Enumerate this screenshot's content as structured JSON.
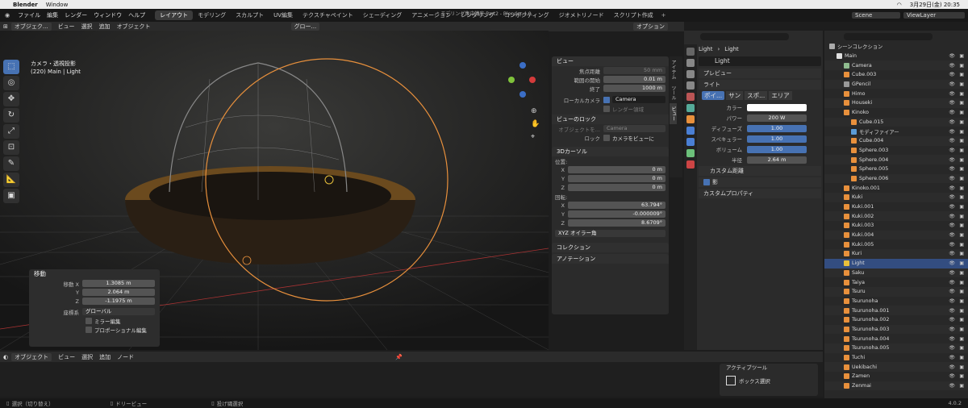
{
  "mac": {
    "app": "Blender",
    "window": "Window",
    "datetime": "3月29日(金) 20:35"
  },
  "title": "* モデリング集中講座 Part2 - Blender 4.0",
  "topmenu": [
    "ファイル",
    "編集",
    "レンダー",
    "ウィンドウ",
    "ヘルプ"
  ],
  "workspaces": [
    "レイアウト",
    "モデリング",
    "スカルプト",
    "UV編集",
    "テクスチャペイント",
    "シェーディング",
    "アニメーション",
    "レンダリング",
    "コンポジティング",
    "ジオメトリノード",
    "スクリプト作成"
  ],
  "scene": "Scene",
  "viewlayer": "ViewLayer",
  "vp_header": {
    "mode": "オブジェク...",
    "menus": [
      "ビュー",
      "選択",
      "追加",
      "オブジェクト"
    ],
    "transform": "グロー...",
    "options": "オプション"
  },
  "vp_overlay": {
    "line1": "カメラ・透視投影",
    "line2": "(220) Main | Light"
  },
  "npanel": {
    "view_title": "ビュー",
    "focal_label": "焦点距離",
    "focal": "50 mm",
    "clip_start_label": "範囲の開始",
    "clip_start": "0.01 m",
    "clip_end_label": "終了",
    "clip_end": "1000 m",
    "local_cam_label": "ローカルカメラ",
    "local_cam": "Camera",
    "render_region": "レンダー領域",
    "lock_title": "ビューのロック",
    "lock_obj_label": "オブジェクトを...",
    "lock_obj": "Camera",
    "lock_label": "ロック",
    "lock_cam": "カメラをビューに",
    "cursor_title": "3Dカーソル",
    "loc_label": "位置:",
    "x": "0 m",
    "y": "0 m",
    "z": "0 m",
    "rot_label": "回転:",
    "rx": "63.794°",
    "ry": "-0.000009°",
    "rz": "8.6709°",
    "rot_mode": "XYZ オイラー角",
    "collection": "コレクション",
    "annotation": "アノテーション"
  },
  "sidetabs": [
    "アイテム",
    "ツール",
    "ビュー"
  ],
  "props": {
    "breadcrumb1": "Light",
    "breadcrumb2": "Light",
    "datablock": "Light",
    "preview": "プレビュー",
    "light": "ライト",
    "types": [
      "ポイ...",
      "サン",
      "スポ...",
      "エリア"
    ],
    "color_label": "カラー",
    "power_label": "パワー",
    "power": "200 W",
    "diffuse_label": "ディフューズ",
    "diffuse": "1.00",
    "specular_label": "スペキュラー",
    "specular": "1.00",
    "volume_label": "ボリューム",
    "volume": "1.00",
    "radius_label": "半径",
    "radius": "2.64 m",
    "custom_dist": "カスタム距離",
    "shadow": "影",
    "custom_props": "カスタムプロパティ"
  },
  "outliner": {
    "root": "シーンコレクション",
    "items": [
      {
        "name": "Main",
        "indent": 1,
        "color": "#e0e0e0"
      },
      {
        "name": "Camera",
        "indent": 2,
        "color": "#8fbc8f"
      },
      {
        "name": "Cube.003",
        "indent": 2,
        "color": "#e8903c"
      },
      {
        "name": "GPencil",
        "indent": 2,
        "color": "#999999"
      },
      {
        "name": "Himo",
        "indent": 2,
        "color": "#e8903c"
      },
      {
        "name": "Houseki",
        "indent": 2,
        "color": "#e8903c"
      },
      {
        "name": "Kinoko",
        "indent": 2,
        "color": "#e8903c"
      },
      {
        "name": "Cube.015",
        "indent": 3,
        "color": "#e8903c"
      },
      {
        "name": "モディファイアー",
        "indent": 3,
        "color": "#5b9bd5"
      },
      {
        "name": "Cube.004",
        "indent": 3,
        "color": "#e8903c"
      },
      {
        "name": "Sphere.003",
        "indent": 3,
        "color": "#e8903c"
      },
      {
        "name": "Sphere.004",
        "indent": 3,
        "color": "#e8903c"
      },
      {
        "name": "Sphere.005",
        "indent": 3,
        "color": "#e8903c"
      },
      {
        "name": "Sphere.006",
        "indent": 3,
        "color": "#e8903c"
      },
      {
        "name": "Kinoko.001",
        "indent": 2,
        "color": "#e8903c"
      },
      {
        "name": "Kuki",
        "indent": 2,
        "color": "#e8903c"
      },
      {
        "name": "Kuki.001",
        "indent": 2,
        "color": "#e8903c"
      },
      {
        "name": "Kuki.002",
        "indent": 2,
        "color": "#e8903c"
      },
      {
        "name": "Kuki.003",
        "indent": 2,
        "color": "#e8903c"
      },
      {
        "name": "Kuki.004",
        "indent": 2,
        "color": "#e8903c"
      },
      {
        "name": "Kuki.005",
        "indent": 2,
        "color": "#e8903c"
      },
      {
        "name": "Kuri",
        "indent": 2,
        "color": "#e8903c"
      },
      {
        "name": "Light",
        "indent": 2,
        "color": "#e8c03c",
        "selected": true
      },
      {
        "name": "Saku",
        "indent": 2,
        "color": "#e8903c"
      },
      {
        "name": "Taiya",
        "indent": 2,
        "color": "#e8903c"
      },
      {
        "name": "Tsuru",
        "indent": 2,
        "color": "#e8903c"
      },
      {
        "name": "Tsurunoha",
        "indent": 2,
        "color": "#e8903c"
      },
      {
        "name": "Tsurunoha.001",
        "indent": 2,
        "color": "#e8903c"
      },
      {
        "name": "Tsurunoha.002",
        "indent": 2,
        "color": "#e8903c"
      },
      {
        "name": "Tsurunoha.003",
        "indent": 2,
        "color": "#e8903c"
      },
      {
        "name": "Tsurunoha.004",
        "indent": 2,
        "color": "#e8903c"
      },
      {
        "name": "Tsurunoha.005",
        "indent": 2,
        "color": "#e8903c"
      },
      {
        "name": "Tuchi",
        "indent": 2,
        "color": "#e8903c"
      },
      {
        "name": "Uekibachi",
        "indent": 2,
        "color": "#e8903c"
      },
      {
        "name": "Zamen",
        "indent": 2,
        "color": "#e8903c"
      },
      {
        "name": "Zenmai",
        "indent": 2,
        "color": "#e8903c"
      }
    ]
  },
  "oppanel": {
    "title": "移動",
    "mx_label": "移動 X",
    "mx": "1.3085 m",
    "my_label": "Y",
    "my": "2.064 m",
    "mz_label": "Z",
    "mz": "-1.1975 m",
    "orient_label": "座標系",
    "orient": "グローバル",
    "mirror": "ミラー編集",
    "prop_edit": "プロポーショナル編集"
  },
  "bottom_header": {
    "mode": "オブジェクト",
    "menus": [
      "ビュー",
      "選択",
      "追加",
      "ノード"
    ]
  },
  "active_tool": {
    "title": "アクティブツール",
    "tool": "ボックス選択"
  },
  "status": {
    "select": "選択（切り替え）",
    "dolly": "ドリービュー",
    "lasso": "投げ縄選択",
    "version": "4.0.2"
  },
  "colors": {
    "accent": "#4772b3",
    "selection": "#334d80",
    "light_ring": "#e8903c"
  }
}
